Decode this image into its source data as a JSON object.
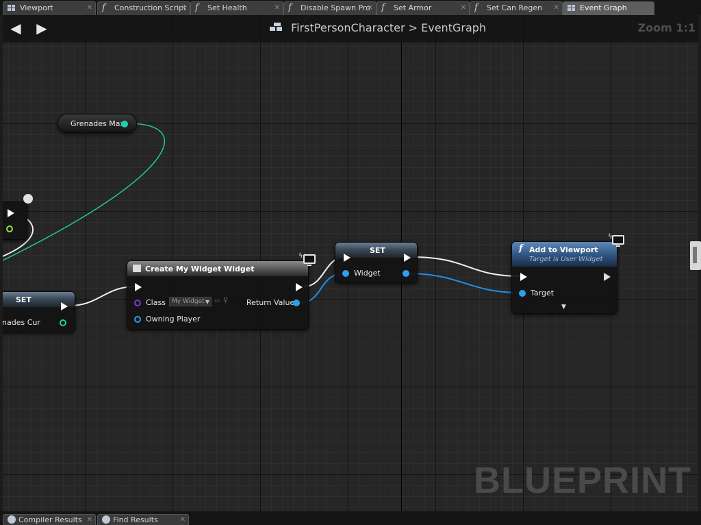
{
  "tabs": [
    {
      "label": "Viewport",
      "icon": "viewport-grid-icon",
      "active": false
    },
    {
      "label": "Construction Script",
      "icon": "function-icon",
      "active": false
    },
    {
      "label": "Set Health",
      "icon": "function-icon",
      "active": false
    },
    {
      "label": "Disable Spawn Pro",
      "icon": "function-icon",
      "active": false
    },
    {
      "label": "Set Armor",
      "icon": "function-icon",
      "active": false
    },
    {
      "label": "Set Can Regen",
      "icon": "function-icon",
      "active": false
    },
    {
      "label": "Event Graph",
      "icon": "event-graph-icon",
      "active": true
    }
  ],
  "header": {
    "breadcrumb_blueprint": "FirstPersonCharacter",
    "breadcrumb_separator": ">",
    "breadcrumb_graph": "EventGraph",
    "zoom": "Zoom 1:1"
  },
  "watermark": "BLUEPRINT",
  "nodes": {
    "grenades_max": {
      "label": "Grenades Max"
    },
    "set_left": {
      "title": "SET",
      "pin_label": "nades Cur"
    },
    "create_widget": {
      "title": "Create My Widget Widget",
      "class_label": "Class",
      "class_value": "My Widget",
      "owning_player_label": "Owning Player",
      "return_label": "Return Value"
    },
    "set_widget": {
      "title": "SET",
      "pin_label": "Widget"
    },
    "add_to_viewport": {
      "title": "Add to Viewport",
      "subtitle": "Target is User Widget",
      "target_label": "Target"
    }
  },
  "colors": {
    "exec_wire": "#f0f0f0",
    "object_wire": "#1f8fe8",
    "int_wire": "#1fc8a0",
    "graph_bg": "#262626"
  },
  "bottom_tabs": [
    {
      "label": "Compiler Results"
    },
    {
      "label": "Find Results"
    }
  ]
}
